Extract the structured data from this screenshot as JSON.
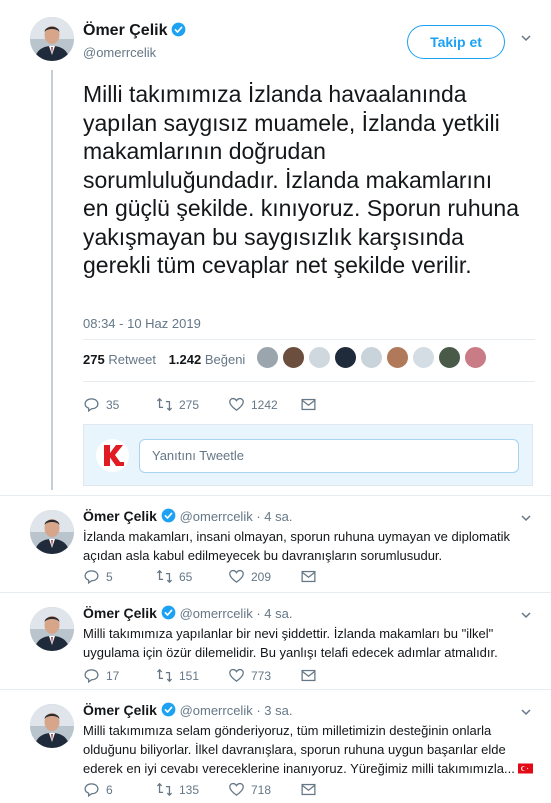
{
  "main_tweet": {
    "author_name": "Ömer Çelik",
    "author_handle": "@omerrcelik",
    "follow_label": "Takip et",
    "text": "Milli takımımıza İzlanda havaalanında yapılan saygısız muamele, İzlanda yetkili makamlarının doğrudan sorumluluğundadır. İzlanda makamlarını en güçlü şekilde. kınıyoruz. Sporun ruhuna yakışmayan bu saygısızlık karşısında gerekli tüm cevaplar net şekilde verilir.",
    "timestamp": "08:34 - 10 Haz 2019",
    "retweet_count": "275",
    "retweet_label": "Retweet",
    "like_count": "1.242",
    "like_label": "Beğeni",
    "actions": {
      "replies": "35",
      "retweets": "275",
      "likes": "1242"
    }
  },
  "reply_box": {
    "placeholder": "Yanıtını Tweetle"
  },
  "replies": [
    {
      "name": "Ömer Çelik",
      "handle": "@omerrcelik",
      "time": "· 4 sa.",
      "text": "İzlanda makamları, insani olmayan, sporun ruhuna uymayan ve diplomatik açıdan asla kabul edilmeyecek bu davranışların sorumlusudur.",
      "replies": "5",
      "retweets": "65",
      "likes": "209"
    },
    {
      "name": "Ömer Çelik",
      "handle": "@omerrcelik",
      "time": "· 4 sa.",
      "text": "Milli takımımıza yapılanlar bir nevi şiddettir. İzlanda makamları bu \"ilkel\" uygulama için özür dilemelidir.  Bu yanlışı telafi edecek adımlar atmalıdır.",
      "replies": "17",
      "retweets": "151",
      "likes": "773"
    },
    {
      "name": "Ömer Çelik",
      "handle": "@omerrcelik",
      "time": "· 3 sa.",
      "text": "Milli takımımıza selam gönderiyoruz, tüm milletimizin desteğinin onlarla olduğunu biliyorlar. İlkel davranışlara, sporun ruhuna uygun başarılar elde ederek en iyi cevabı vereceklerine inanıyoruz. Yüreğimiz milli takımımızla...",
      "replies": "6",
      "retweets": "135",
      "likes": "718"
    }
  ],
  "colors": {
    "accent": "#1da1f2",
    "muted": "#657786",
    "text": "#14171a"
  }
}
